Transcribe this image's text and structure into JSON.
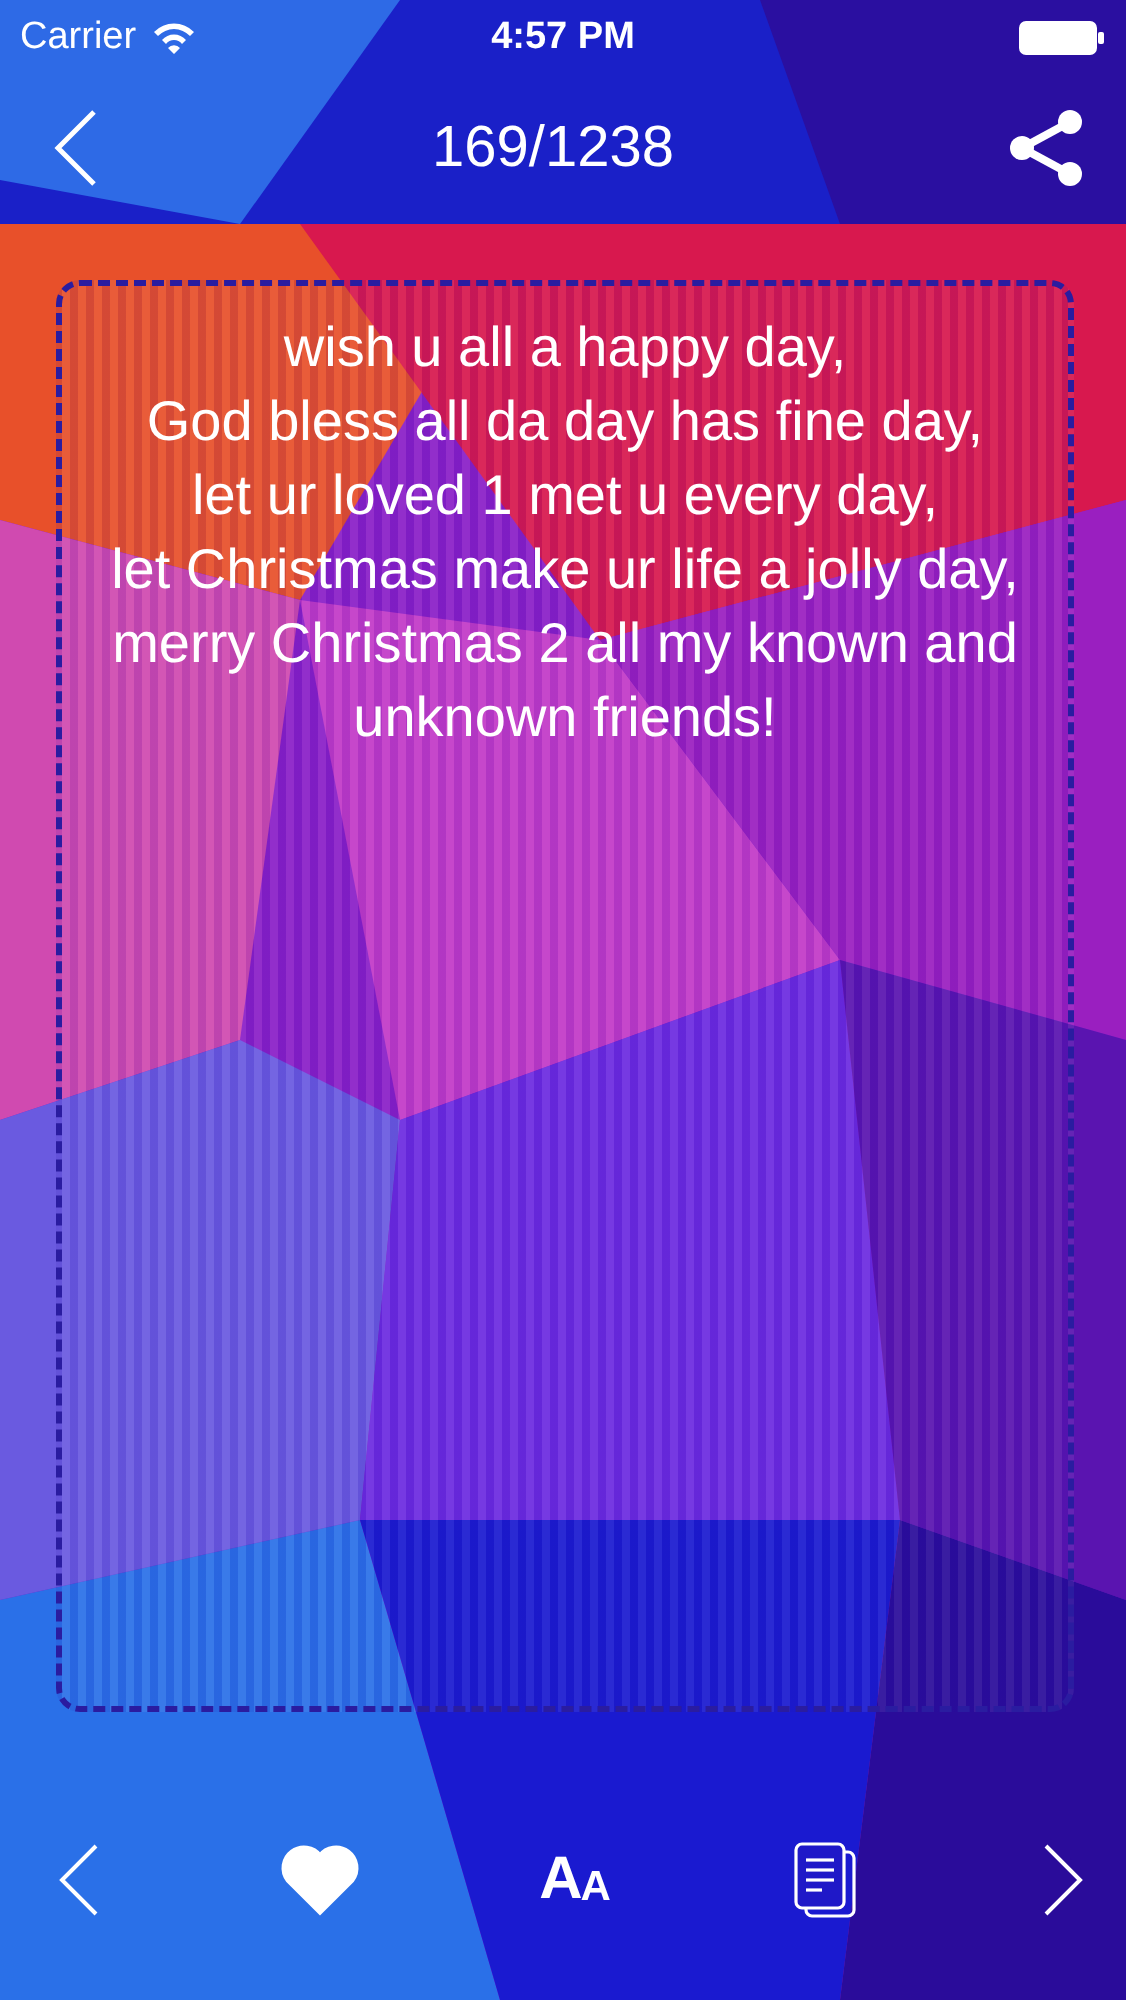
{
  "status_bar": {
    "carrier": "Carrier",
    "time": "4:57 PM"
  },
  "nav_bar": {
    "title": "169/1238"
  },
  "message": {
    "lines": [
      "wish u all a happy day,",
      "God bless all da day has fine day,",
      "let ur loved 1 met u every day,",
      "let Christmas make ur life a jolly day,",
      "merry Christmas 2 all my known and unknown friends!"
    ]
  },
  "toolbar": {
    "favorite": true,
    "font_label": "AA"
  }
}
